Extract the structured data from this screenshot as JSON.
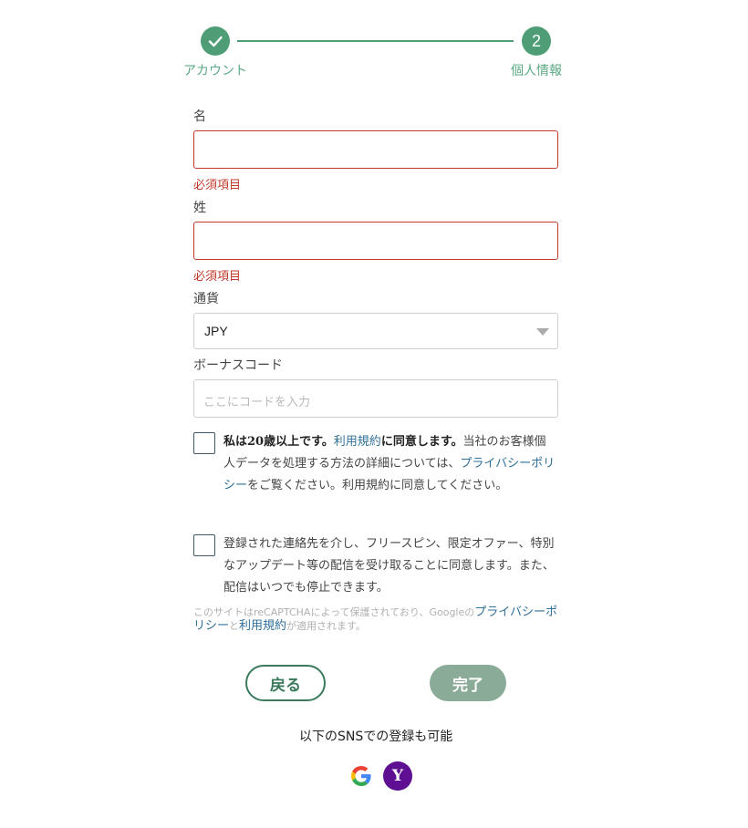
{
  "stepper": {
    "step1_label": "アカウント",
    "step2_number": "2",
    "step2_label": "個人情報",
    "accent_color": "#4f9d76"
  },
  "form": {
    "first_name": {
      "label": "名",
      "value": "",
      "error": "必須項目"
    },
    "last_name": {
      "label": "姓",
      "value": "",
      "error": "必須項目"
    },
    "currency": {
      "label": "通貨",
      "selected": "JPY"
    },
    "bonus_code": {
      "label": "ボーナスコード",
      "placeholder": "ここにコードを入力"
    }
  },
  "consent_age": {
    "part1": "私は20歳以上です。",
    "link_terms": "利用規約",
    "part2": "に同意します。",
    "part3": "当社のお客様個人データを処理する方法の詳細については、",
    "link_privacy": "プライバシーポリシー",
    "part4": "をご覧ください。利用規約に同意してください。"
  },
  "consent_marketing": {
    "text": "登録された連絡先を介し、フリースピン、限定オファー、特別なアップデート等の配信を受け取ることに同意します。また、配信はいつでも停止できます。"
  },
  "recaptcha": {
    "part1": "このサイトはreCAPTCHAによって保護されており、Googleの",
    "link_privacy": "プライバシーポリシー",
    "part2": "と",
    "link_terms": "利用規約",
    "part3": "が適用されます。"
  },
  "buttons": {
    "back": "戻る",
    "done": "完了"
  },
  "sns": {
    "label": "以下のSNSでの登録も可能",
    "google_icon": "google-icon",
    "yahoo_icon": "yahoo-icon",
    "yahoo_glyph": "Y"
  }
}
